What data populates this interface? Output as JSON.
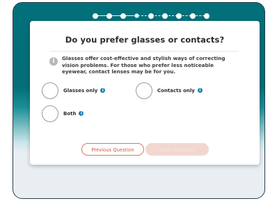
{
  "progress": {
    "total_steps": 9,
    "current_step": 4
  },
  "question": {
    "title": "Do you prefer glasses or contacts?",
    "info": "Glasses offer cost-effective and stylish ways of correcting vision problems. For those who prefer less noticeable eyewear, contact lenses may be for you."
  },
  "options": [
    {
      "label": "Glasses only",
      "tip_icon": "info-icon"
    },
    {
      "label": "Contacts only",
      "tip_icon": "info-icon"
    },
    {
      "label": "Both",
      "tip_icon": "info-icon"
    }
  ],
  "buttons": {
    "previous": "Previous Question",
    "next": "Next Question"
  },
  "colors": {
    "header_teal": "#02707a",
    "accent_orange": "#cf5a3c",
    "tip_blue": "#1a7fb8"
  }
}
